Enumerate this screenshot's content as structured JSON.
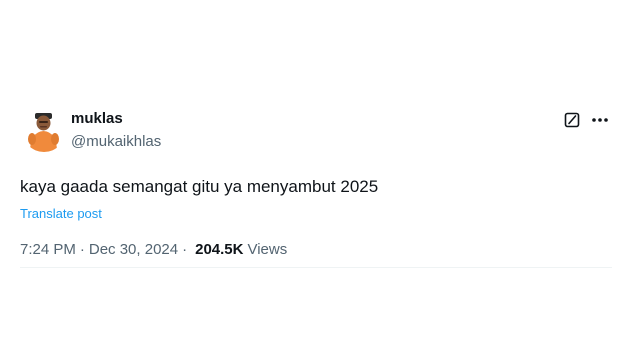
{
  "tweet": {
    "display_name": "muklas",
    "handle": "@mukaikhlas",
    "text": "kaya gaada semangat gitu ya menyambut 2025",
    "translate_label": "Translate post",
    "time": "7:24 PM",
    "separator": "·",
    "date": "Dec 30, 2024",
    "views_count": "204.5K",
    "views_label": "Views"
  },
  "icons": {
    "grok": "grok-icon",
    "more": "more-icon",
    "avatar": "avatar"
  },
  "colors": {
    "text": "#0f1419",
    "muted": "#536471",
    "link": "#1d9bf0",
    "avatar_shirt": "#f08a3c",
    "divider": "#eff3f4"
  }
}
